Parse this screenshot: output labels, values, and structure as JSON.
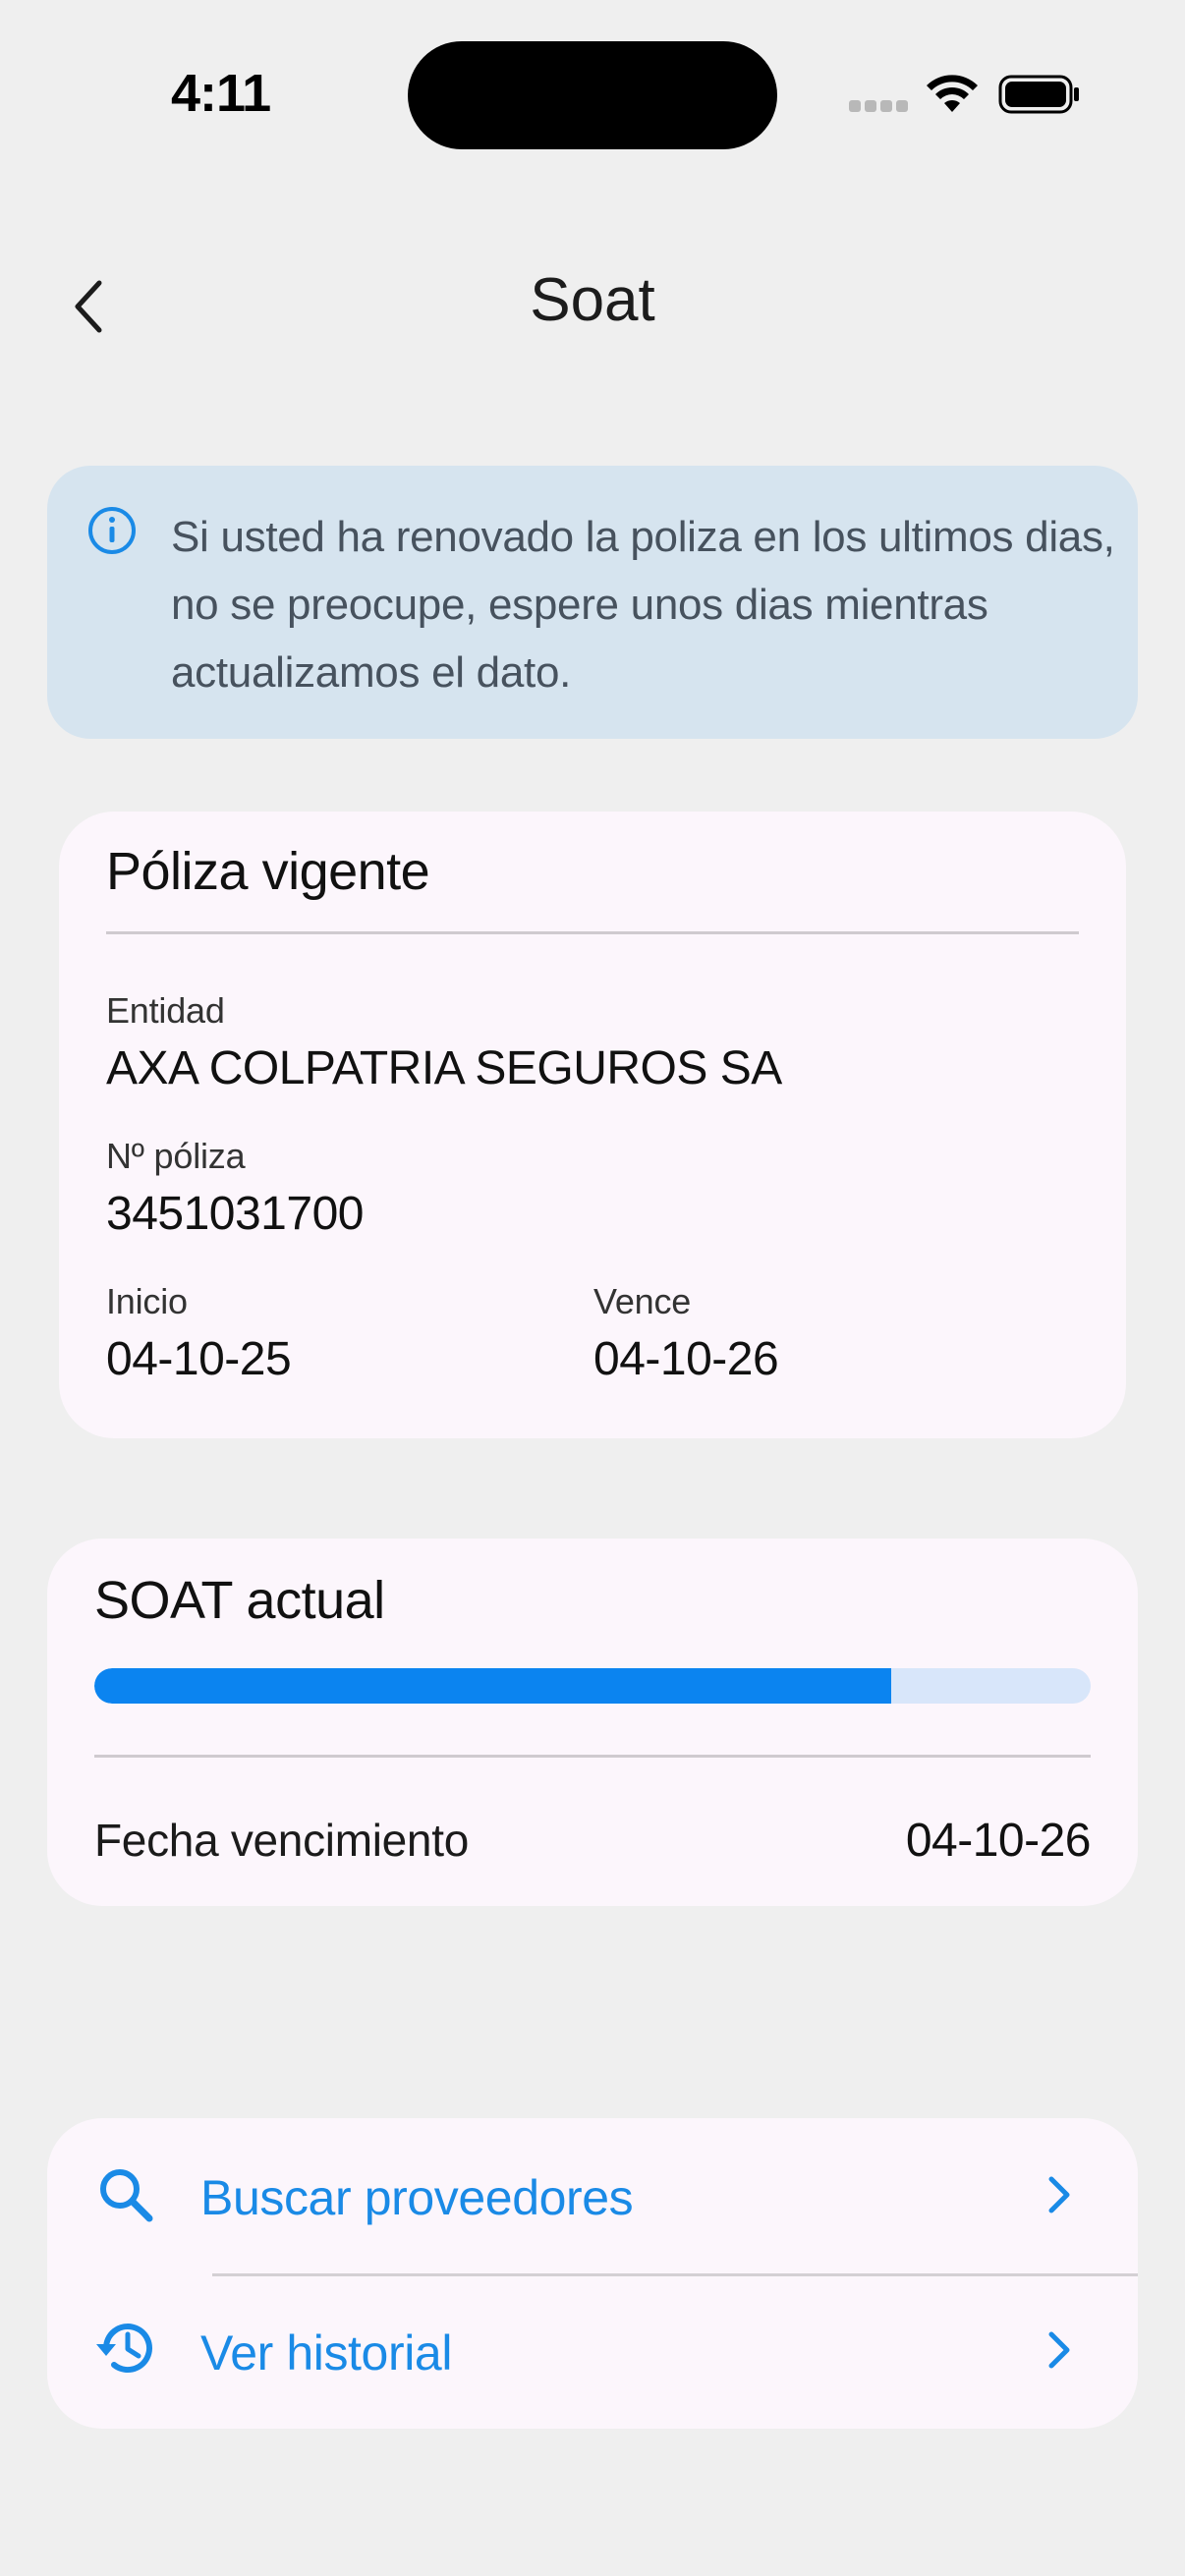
{
  "status_bar": {
    "time": "4:11"
  },
  "nav": {
    "title": "Soat",
    "back_icon": "chevron-left-icon"
  },
  "info_banner": {
    "icon": "info-icon",
    "text": "Si usted ha renovado la poliza en los ultimos dias, no se preocupe, espere unos dias mientras actualizamos el dato."
  },
  "policy": {
    "title": "Póliza vigente",
    "entity_label": "Entidad",
    "entity_value": "AXA COLPATRIA SEGUROS SA",
    "number_label": "Nº póliza",
    "number_value": "3451031700",
    "start_label": "Inicio",
    "start_value": "04-10-25",
    "end_label": "Vence",
    "end_value": "04-10-26"
  },
  "soat_current": {
    "title": "SOAT actual",
    "progress_fraction": 0.8,
    "expiry_label": "Fecha vencimiento",
    "expiry_value": "04-10-26"
  },
  "actions": [
    {
      "label": "Buscar proveedores",
      "icon": "search-icon"
    },
    {
      "label": "Ver historial",
      "icon": "history-icon"
    }
  ],
  "colors": {
    "accent": "#0b84f0",
    "link": "#1a8ae6",
    "banner_bg": "#d6e4ef",
    "card_bg": "#fcf6fc",
    "page_bg": "#efefef"
  }
}
